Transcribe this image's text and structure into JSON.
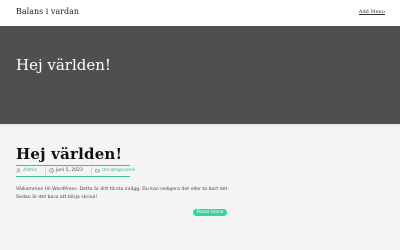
{
  "header": {
    "site_title": "Balans i vardan",
    "menu_link": "Add Menu"
  },
  "hero": {
    "title": "Hej världen!"
  },
  "post": {
    "title": "Hej världen!",
    "meta": {
      "author": "Admin",
      "date": "juni 5, 2023",
      "category": "Uncategorized",
      "accent_color": "#34c98b"
    },
    "excerpt_line1": "Välkommen till WordPress. Detta är ditt första inlägg. Du kan redigera det eller ta bort det.",
    "excerpt_line2": "Sedan är det bara att börja skriva!",
    "read_more": "Read More"
  },
  "colors": {
    "hero_bg": "#4f4f4f",
    "button_bg": "#38d39a"
  }
}
